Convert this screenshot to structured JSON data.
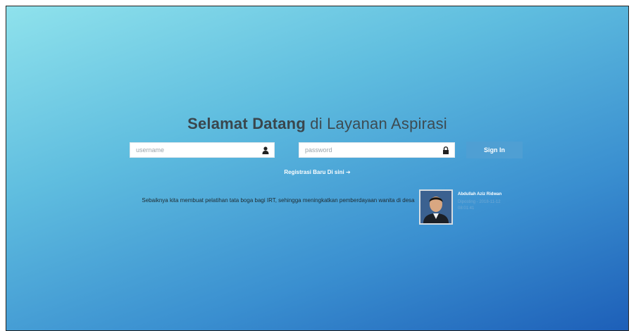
{
  "page": {
    "title_bold": "Selamat Datang",
    "title_rest": " di Layanan Aspirasi"
  },
  "login": {
    "username_placeholder": "username",
    "password_placeholder": "password",
    "signin_label": "Sign In",
    "register_label": "Registrasi Baru Di sini",
    "register_icon": "arrow-right-icon"
  },
  "aspiration": {
    "text": "Sebaiknya kita membuat pelatihan tata boga bagi IRT, sehingga meningkatkan pemberdayaan wanita di desa",
    "author_name": "Abdullah Aziz Ridwan",
    "author_meta": "Diposting - 2018-11-12 08:01:41"
  },
  "icons": {
    "username": "user-icon",
    "password": "lock-icon"
  },
  "colors": {
    "gradient_start": "#8fe2ec",
    "gradient_end": "#1d5fb8",
    "signin_bg": "#4f9fd3",
    "title_color": "#3a464d"
  }
}
